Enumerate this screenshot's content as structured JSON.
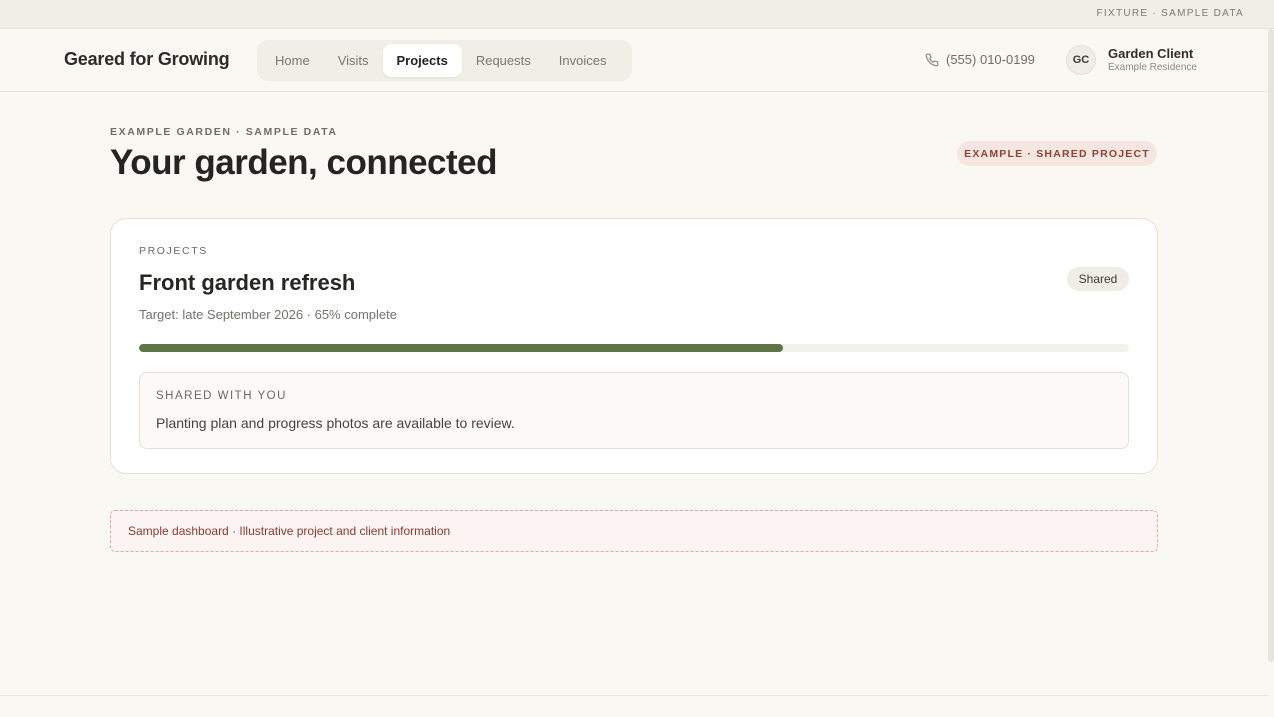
{
  "fixture_label": "FIXTURE · SAMPLE DATA",
  "brand": "Geared for Growing",
  "nav": {
    "tabs": [
      {
        "label": "Home"
      },
      {
        "label": "Visits"
      },
      {
        "label": "Projects",
        "active": true
      },
      {
        "label": "Requests"
      },
      {
        "label": "Invoices"
      }
    ]
  },
  "header": {
    "phone": "(555) 010-0199",
    "avatar_initials": "GC",
    "user_name": "Garden Client",
    "user_subtitle": "Example Residence"
  },
  "page": {
    "eyebrow": "EXAMPLE GARDEN · SAMPLE DATA",
    "title": "Your garden, connected",
    "badge": "EXAMPLE · SHARED PROJECT"
  },
  "project": {
    "section_label": "PROJECTS",
    "title": "Front garden refresh",
    "status": "Shared",
    "meta": "Target: late September 2026 · 65% complete",
    "progress_percent": 65,
    "shared_title": "SHARED WITH YOU",
    "shared_text": "Planting plan and progress photos are available to review."
  },
  "notice": "Sample dashboard · Illustrative project and client information",
  "colors": {
    "accent_green": "#5d7546",
    "badge_red_text": "#8c4436",
    "badge_red_bg": "#f6e6e2",
    "page_bg": "#f9f8f3"
  },
  "icons": {
    "phone": "phone-icon"
  }
}
